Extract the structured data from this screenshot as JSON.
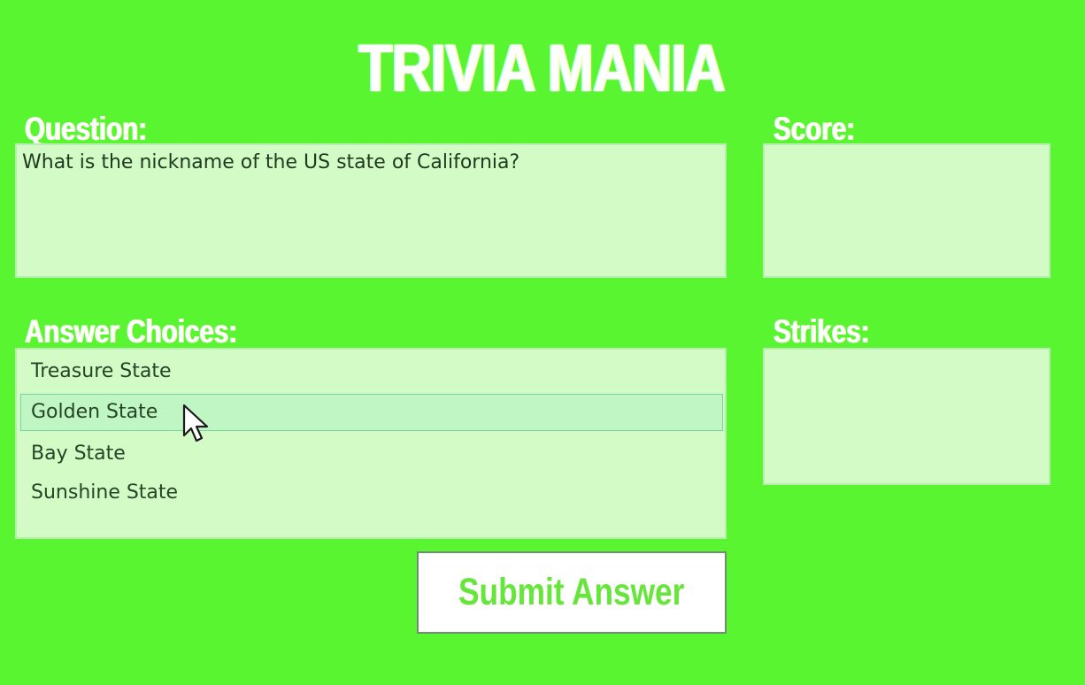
{
  "app": {
    "title": "TRIVIA MANIA"
  },
  "question": {
    "label": "Question:",
    "text": "What is the nickname of the US state of California?"
  },
  "score": {
    "label": "Score:",
    "value": ""
  },
  "answers": {
    "label": "Answer Choices:",
    "items": [
      {
        "label": "Treasure State",
        "selected": false
      },
      {
        "label": "Golden State",
        "selected": true
      },
      {
        "label": "Bay State",
        "selected": false
      },
      {
        "label": "Sunshine State",
        "selected": false
      }
    ]
  },
  "strikes": {
    "label": "Strikes:",
    "value": ""
  },
  "submit": {
    "label": "Submit Answer"
  },
  "icons": {
    "cursor": "mouse-pointer-icon"
  },
  "colors": {
    "background": "#5af531",
    "panel": "#d3fbc6",
    "selected_row": "#c0f6c4",
    "button_text": "#66e63a"
  }
}
